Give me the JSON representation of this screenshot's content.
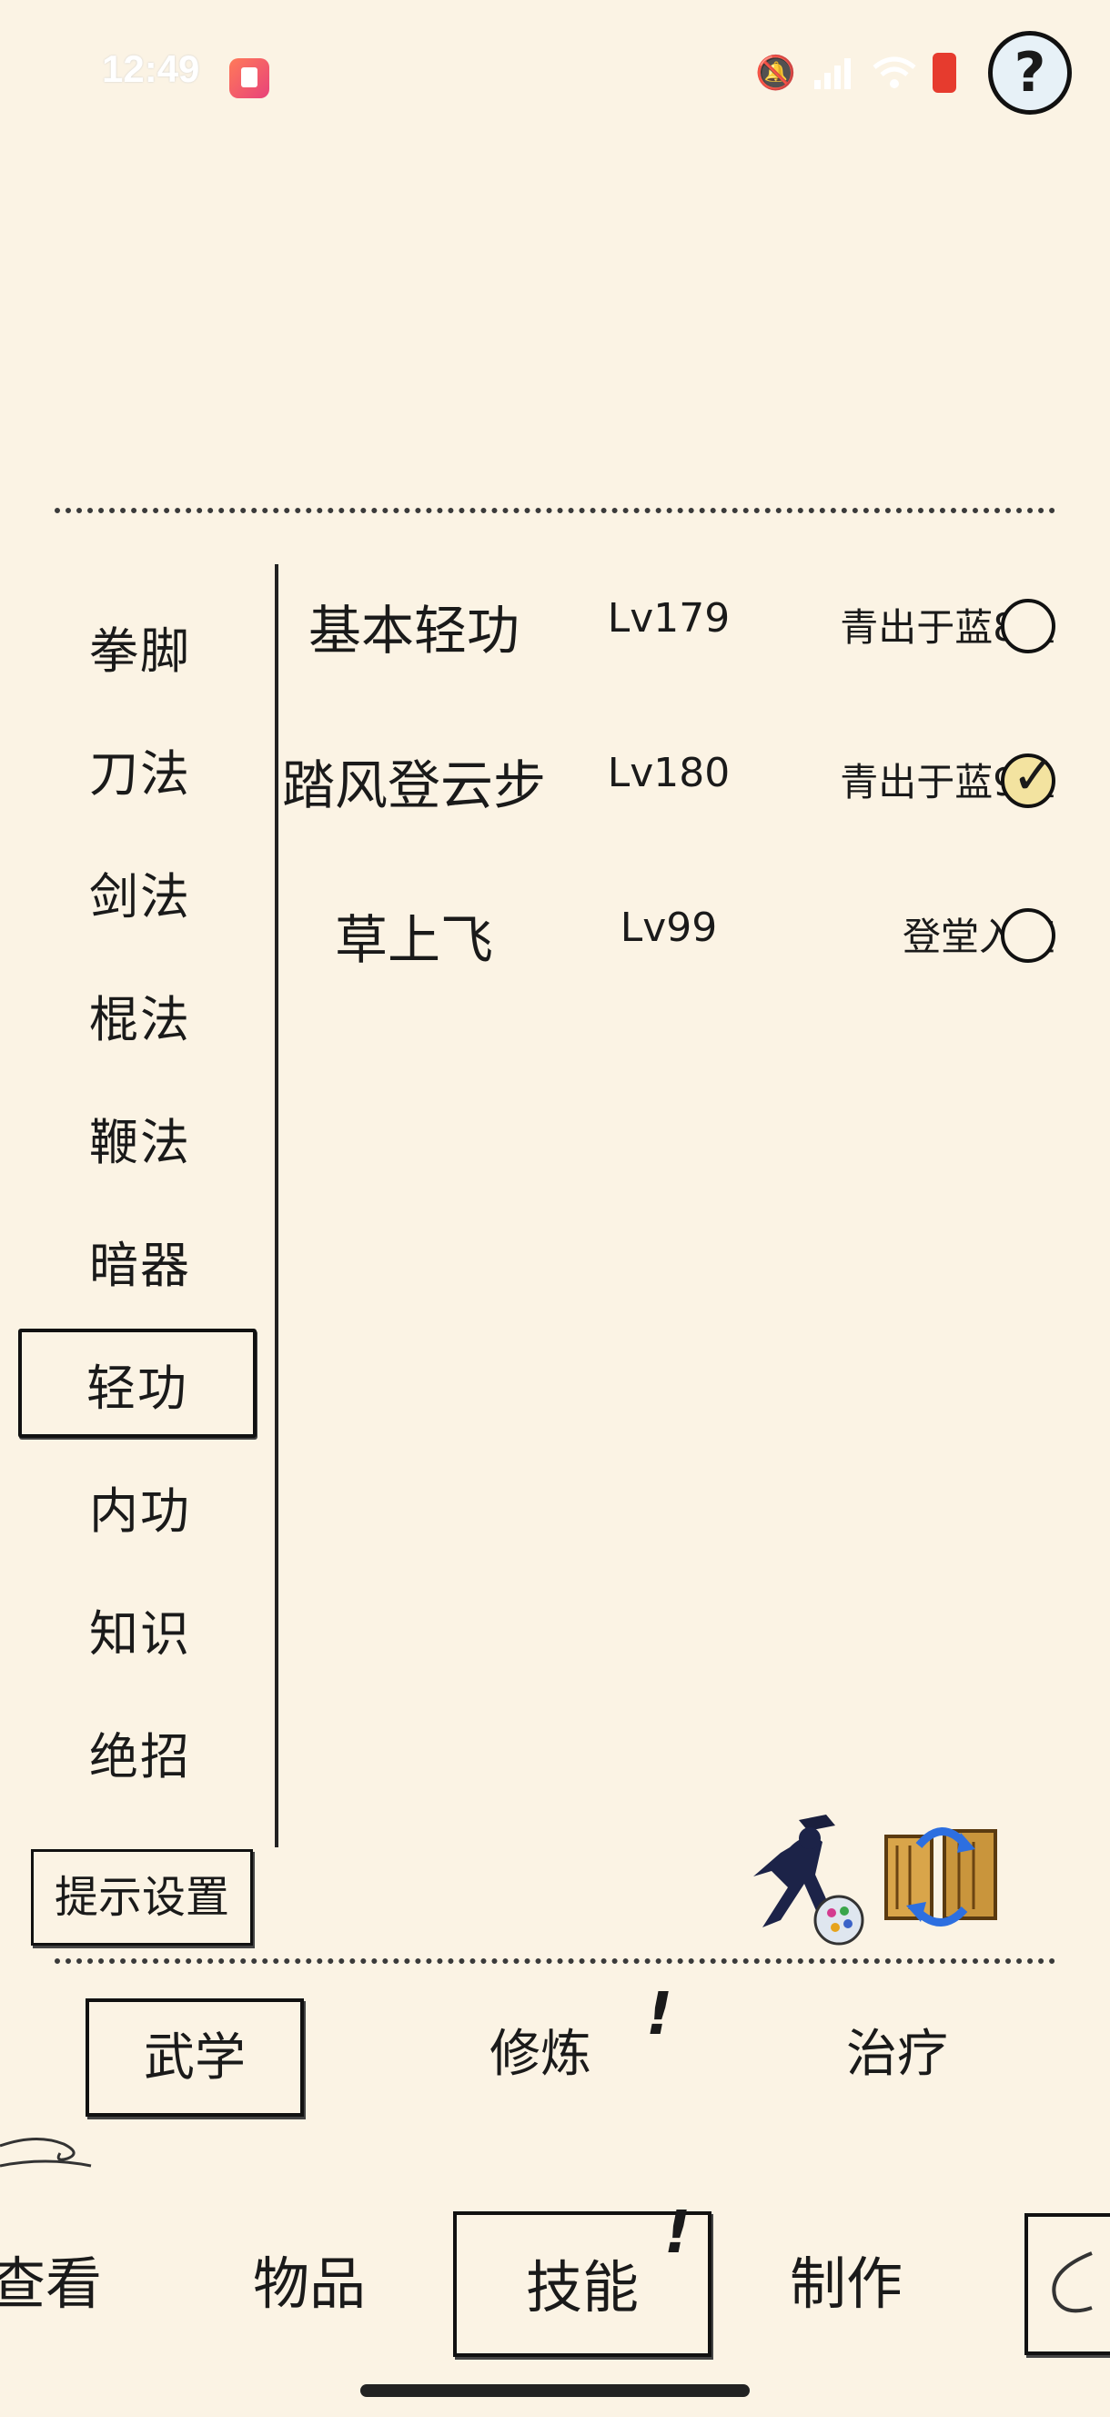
{
  "status_bar": {
    "time": "12:49",
    "icons": [
      "app-icon",
      "mute-icon",
      "signal-5g-icon",
      "wifi-icon",
      "battery-icon"
    ]
  },
  "categories": [
    {
      "label": "拳脚"
    },
    {
      "label": "刀法"
    },
    {
      "label": "剑法"
    },
    {
      "label": "棍法"
    },
    {
      "label": "鞭法"
    },
    {
      "label": "暗器"
    },
    {
      "label": "轻功",
      "active": true
    },
    {
      "label": "内功"
    },
    {
      "label": "知识"
    },
    {
      "label": "绝招"
    }
  ],
  "skills": [
    {
      "name": "基本轻功",
      "level": "Lv179",
      "rank": "青出于蓝8重",
      "selected": false
    },
    {
      "name": "踏风登云步",
      "level": "Lv180",
      "rank": "青出于蓝9重",
      "selected": true
    },
    {
      "name": "草上飞",
      "level": "Lv99",
      "rank": "登堂入室",
      "selected": false
    }
  ],
  "hint_settings": {
    "label": "提示设置"
  },
  "sub_tabs": [
    {
      "label": "武学",
      "active": true,
      "alert": false
    },
    {
      "label": "修炼",
      "active": false,
      "alert": true
    },
    {
      "label": "治疗",
      "active": false,
      "alert": false
    }
  ],
  "bottom_nav": [
    {
      "label": "查看",
      "active": false,
      "alert": false
    },
    {
      "label": "物品",
      "active": false,
      "alert": false
    },
    {
      "label": "技能",
      "active": true,
      "alert": true
    },
    {
      "label": "制作",
      "active": false,
      "alert": false
    }
  ],
  "alert_mark": "!",
  "colors": {
    "background": "#fbf3e4",
    "ink": "#1a1a1a",
    "help_bg": "#e7f1f7",
    "battery": "#e63b2e"
  }
}
